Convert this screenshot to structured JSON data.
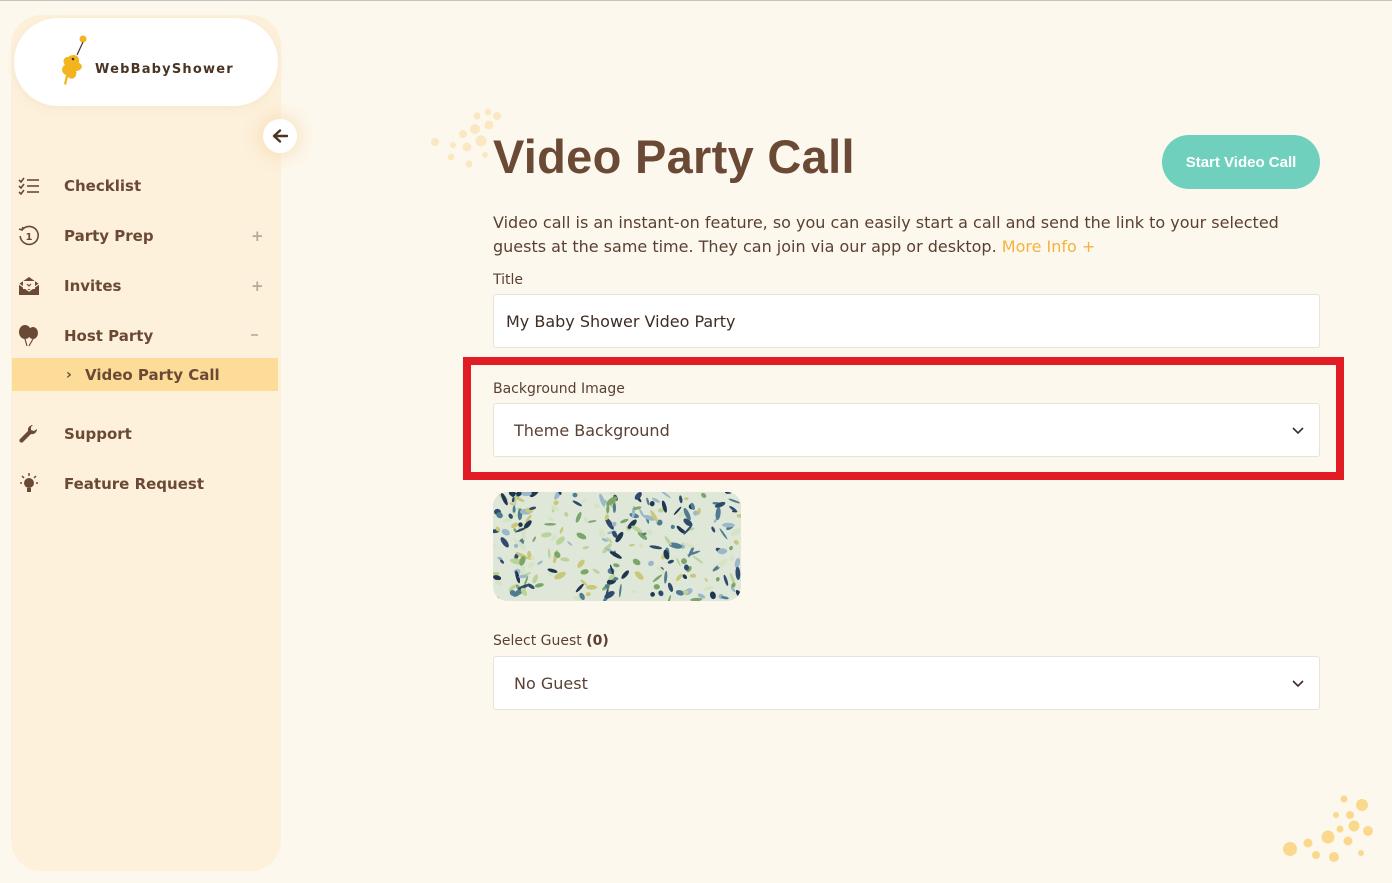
{
  "brand": {
    "name": "WebBabyShower"
  },
  "sidebar": {
    "items": [
      {
        "label": "Checklist",
        "icon": "checklist-icon",
        "expand": ""
      },
      {
        "label": "Party Prep",
        "icon": "clock-history-icon",
        "expand": "+"
      },
      {
        "label": "Invites",
        "icon": "envelope-open-icon",
        "expand": "+"
      },
      {
        "label": "Host Party",
        "icon": "balloons-icon",
        "expand": "-"
      },
      {
        "label": "Support",
        "icon": "wrench-icon",
        "expand": ""
      },
      {
        "label": "Feature Request",
        "icon": "lightbulb-icon",
        "expand": ""
      }
    ],
    "active_sub": {
      "label": "Video Party Call"
    }
  },
  "main": {
    "title": "Video Party Call",
    "start_button": "Start Video Call",
    "description": "Video call is an instant-on feature, so you can easily start a call and send the link to your selected guests at the same time. They can join via our app or desktop.",
    "more_info": "More Info +",
    "title_field": {
      "label": "Title",
      "value": "My Baby Shower Video Party"
    },
    "background_field": {
      "label": "Background Image",
      "value": "Theme Background"
    },
    "guest_field": {
      "label": "Select Guest",
      "count": "(0)",
      "value": "No Guest"
    }
  },
  "colors": {
    "accent_teal": "#6fd1bd",
    "active_yellow": "#fddc99",
    "link_orange": "#f3b33e",
    "text_brown": "#6b4a35",
    "highlight_red": "#e21c24"
  }
}
